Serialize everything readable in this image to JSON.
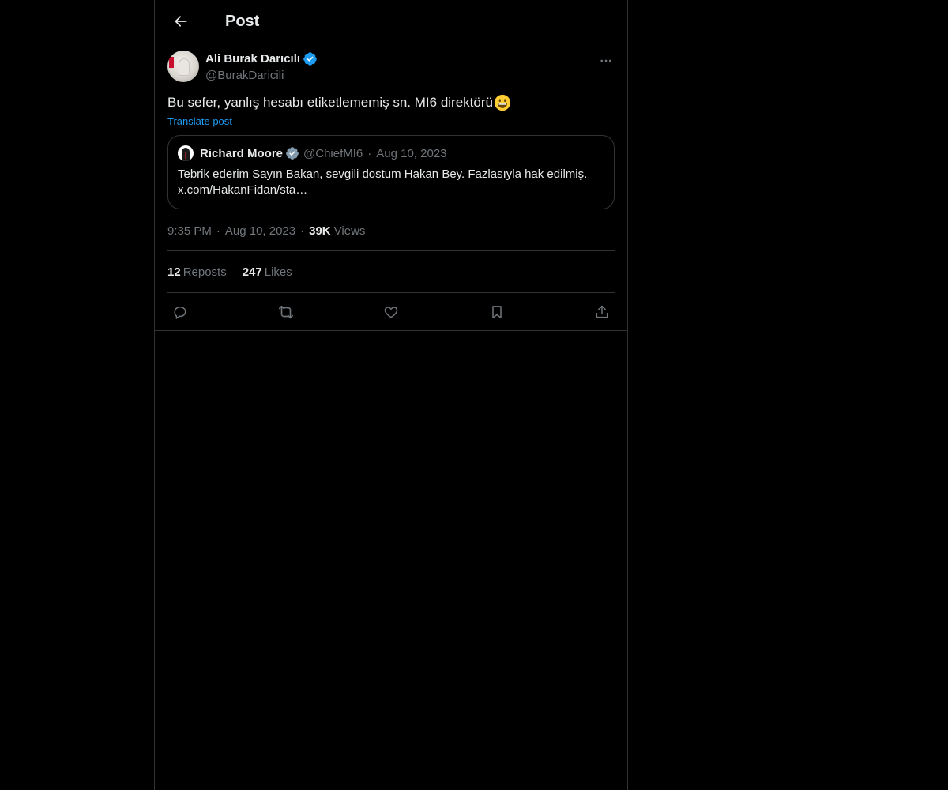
{
  "header": {
    "title": "Post"
  },
  "post": {
    "author": {
      "display_name": "Ali Burak Darıcılı",
      "handle": "@BurakDaricili"
    },
    "text": "Bu sefer, yanlış hesabı etiketlememiş sn. MI6 direktörü",
    "emoji": "grinning-face-emoji",
    "translate_label": "Translate post",
    "quote": {
      "display_name": "Richard Moore",
      "handle": "@ChiefMI6",
      "separator": "·",
      "date": "Aug 10, 2023",
      "text_line1": "Tebrik ederim Sayın Bakan, sevgili dostum Hakan Bey.  Fazlasıyla hak edilmiş.",
      "text_line2": "x.com/HakanFidan/sta…"
    },
    "meta": {
      "time": "9:35 PM",
      "separator": "·",
      "date": "Aug 10, 2023",
      "views_count": "39K",
      "views_label": "Views"
    },
    "stats": {
      "reposts_count": "12",
      "reposts_label": "Reposts",
      "likes_count": "247",
      "likes_label": "Likes"
    }
  },
  "colors": {
    "background": "#000000",
    "text_primary": "#e7e9ea",
    "text_secondary": "#71767b",
    "accent": "#1d9bf0",
    "border": "#2f3336",
    "verified_blue": "#1d9bf0",
    "verified_gray": "#829aab"
  },
  "icons": {
    "back": "arrow-left-icon",
    "more": "more-horizontal-icon",
    "verified": "verified-badge-icon",
    "reply": "reply-icon",
    "repost": "repost-icon",
    "like": "heart-icon",
    "bookmark": "bookmark-icon",
    "share": "share-icon"
  }
}
